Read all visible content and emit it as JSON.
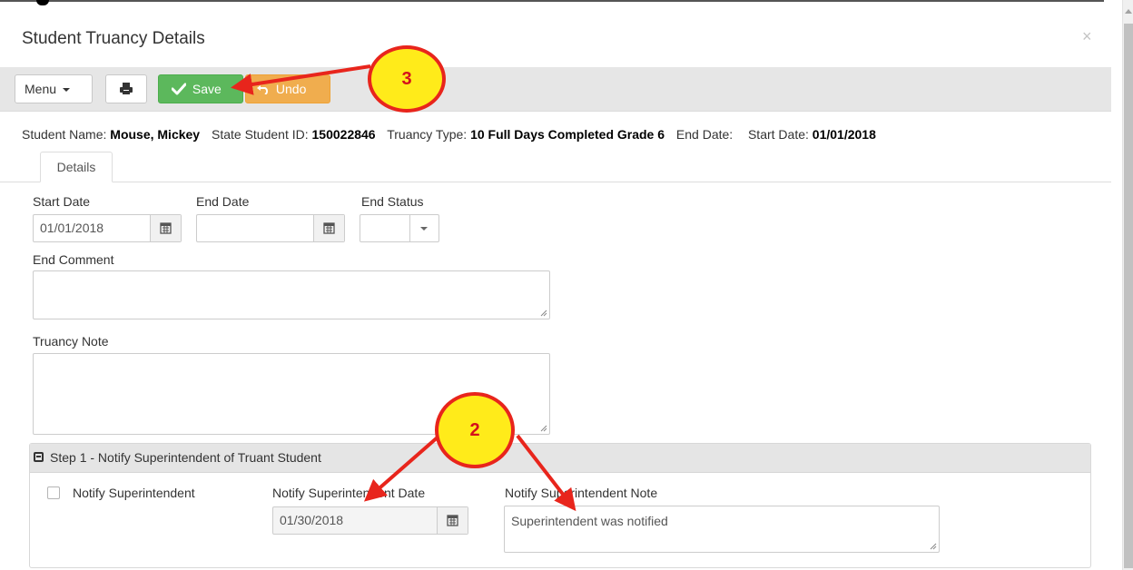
{
  "modal": {
    "title": "Student Truancy Details",
    "close_glyph": "×"
  },
  "toolbar": {
    "menu_label": "Menu",
    "save_label": "Save",
    "undo_label": "Undo"
  },
  "student_info": {
    "name_label": "Student Name:",
    "name_value": "Mouse, Mickey",
    "state_id_label": "State Student ID:",
    "state_id_value": "150022846",
    "truancy_type_label": "Truancy Type:",
    "truancy_type_value": "10 Full Days Completed Grade 6",
    "end_date_label": "End Date:",
    "end_date_value": "",
    "start_date_label": "Start Date:",
    "start_date_value": "01/01/2018"
  },
  "tabs": [
    {
      "label": "Details",
      "active": true
    }
  ],
  "form": {
    "start_date_label": "Start Date",
    "start_date_value": "01/01/2018",
    "end_date_label": "End Date",
    "end_date_value": "",
    "end_status_label": "End Status",
    "end_status_value": "",
    "end_comment_label": "End Comment",
    "end_comment_value": "",
    "truancy_note_label": "Truancy Note",
    "truancy_note_value": ""
  },
  "step1": {
    "title": "Step 1 - Notify Superintendent of Truant Student",
    "checkbox_label": "Notify Superintendent",
    "checked": false,
    "date_label": "Notify Superintendent Date",
    "date_value": "01/30/2018",
    "note_label": "Notify Superintendent Note",
    "note_value": "Superintendent was notified"
  },
  "annotations": [
    {
      "number": "2"
    },
    {
      "number": "3"
    }
  ],
  "colors": {
    "save_green": "#5cb85c",
    "undo_orange": "#f0ad4e",
    "toolbar_gray": "#e6e6e6",
    "annotation_red": "#e8251c",
    "annotation_yellow": "#ffeb1a"
  },
  "icons": {
    "menu_caret": "caret-down-icon",
    "print": "print-icon",
    "save": "check-icon",
    "undo": "undo-icon",
    "calendar": "calendar-icon",
    "section_toggle": "collapse-icon",
    "close": "close-icon"
  }
}
